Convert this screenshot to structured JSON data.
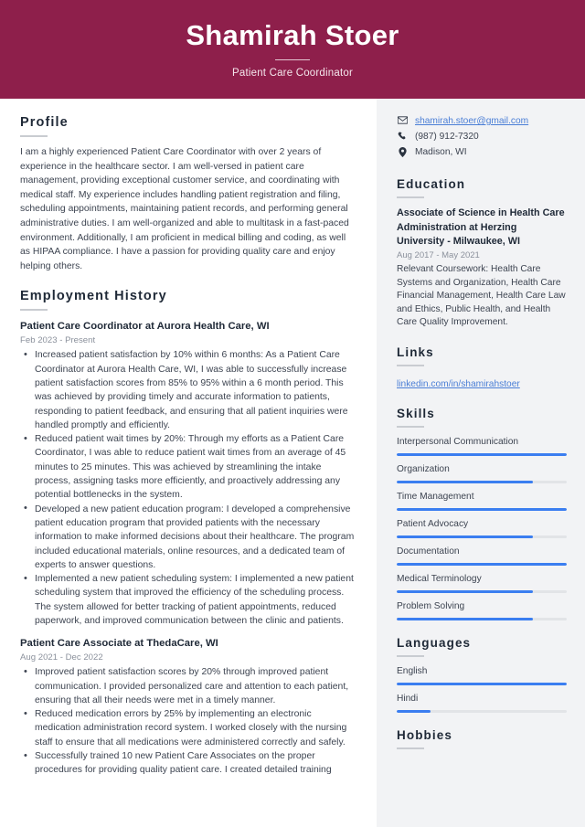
{
  "header": {
    "name": "Shamirah Stoer",
    "title": "Patient Care Coordinator",
    "bg_color": "#8e1f4b"
  },
  "accent": {
    "bar_color": "#3b7ef0",
    "link_color": "#4a7ed6",
    "heading_color": "#1f2937"
  },
  "main": {
    "profile": {
      "heading": "Profile",
      "text": "I am a highly experienced Patient Care Coordinator with over 2 years of experience in the healthcare sector. I am well-versed in patient care management, providing exceptional customer service, and coordinating with medical staff. My experience includes handling patient registration and filing, scheduling appointments, maintaining patient records, and performing general administrative duties. I am well-organized and able to multitask in a fast-paced environment. Additionally, I am proficient in medical billing and coding, as well as HIPAA compliance. I have a passion for providing quality care and enjoy helping others."
    },
    "employment": {
      "heading": "Employment History",
      "jobs": [
        {
          "title": "Patient Care Coordinator at Aurora Health Care, WI",
          "date": "Feb 2023 - Present",
          "bullets": [
            "Increased patient satisfaction by 10% within 6 months: As a Patient Care Coordinator at Aurora Health Care, WI, I was able to successfully increase patient satisfaction scores from 85% to 95% within a 6 month period. This was achieved by providing timely and accurate information to patients, responding to patient feedback, and ensuring that all patient inquiries were handled promptly and efficiently.",
            "Reduced patient wait times by 20%: Through my efforts as a Patient Care Coordinator, I was able to reduce patient wait times from an average of 45 minutes to 25 minutes. This was achieved by streamlining the intake process, assigning tasks more efficiently, and proactively addressing any potential bottlenecks in the system.",
            "Developed a new patient education program: I developed a comprehensive patient education program that provided patients with the necessary information to make informed decisions about their healthcare. The program included educational materials, online resources, and a dedicated team of experts to answer questions.",
            "Implemented a new patient scheduling system: I implemented a new patient scheduling system that improved the efficiency of the scheduling process. The system allowed for better tracking of patient appointments, reduced paperwork, and improved communication between the clinic and patients."
          ]
        },
        {
          "title": "Patient Care Associate at ThedaCare, WI",
          "date": "Aug 2021 - Dec 2022",
          "bullets": [
            "Improved patient satisfaction scores by 20% through improved patient communication. I provided personalized care and attention to each patient, ensuring that all their needs were met in a timely manner.",
            "Reduced medication errors by 25% by implementing an electronic medication administration record system. I worked closely with the nursing staff to ensure that all medications were administered correctly and safely.",
            "Successfully trained 10 new Patient Care Associates on the proper procedures for providing quality patient care. I created detailed training"
          ]
        }
      ]
    }
  },
  "sidebar": {
    "contact": {
      "email": "shamirah.stoer@gmail.com",
      "phone": "(987) 912-7320",
      "location": "Madison, WI",
      "email_icon": "envelope-icon",
      "phone_icon": "phone-icon",
      "location_icon": "map-pin-icon"
    },
    "education": {
      "heading": "Education",
      "items": [
        {
          "title": "Associate of Science in Health Care Administration at Herzing University - Milwaukee, WI",
          "date": "Aug 2017 - May 2021",
          "description": "Relevant Coursework: Health Care Systems and Organization, Health Care Financial Management, Health Care Law and Ethics, Public Health, and Health Care Quality Improvement."
        }
      ]
    },
    "links": {
      "heading": "Links",
      "items": [
        {
          "label": "linkedin.com/in/shamirahstoer"
        }
      ]
    },
    "skills": {
      "heading": "Skills",
      "items": [
        {
          "label": "Interpersonal Communication",
          "level": 100
        },
        {
          "label": "Organization",
          "level": 80
        },
        {
          "label": "Time Management",
          "level": 100
        },
        {
          "label": "Patient Advocacy",
          "level": 80
        },
        {
          "label": "Documentation",
          "level": 100
        },
        {
          "label": "Medical Terminology",
          "level": 80
        },
        {
          "label": "Problem Solving",
          "level": 80
        }
      ]
    },
    "languages": {
      "heading": "Languages",
      "items": [
        {
          "label": "English",
          "level": 100
        },
        {
          "label": "Hindi",
          "level": 20
        }
      ]
    },
    "hobbies": {
      "heading": "Hobbies"
    }
  }
}
